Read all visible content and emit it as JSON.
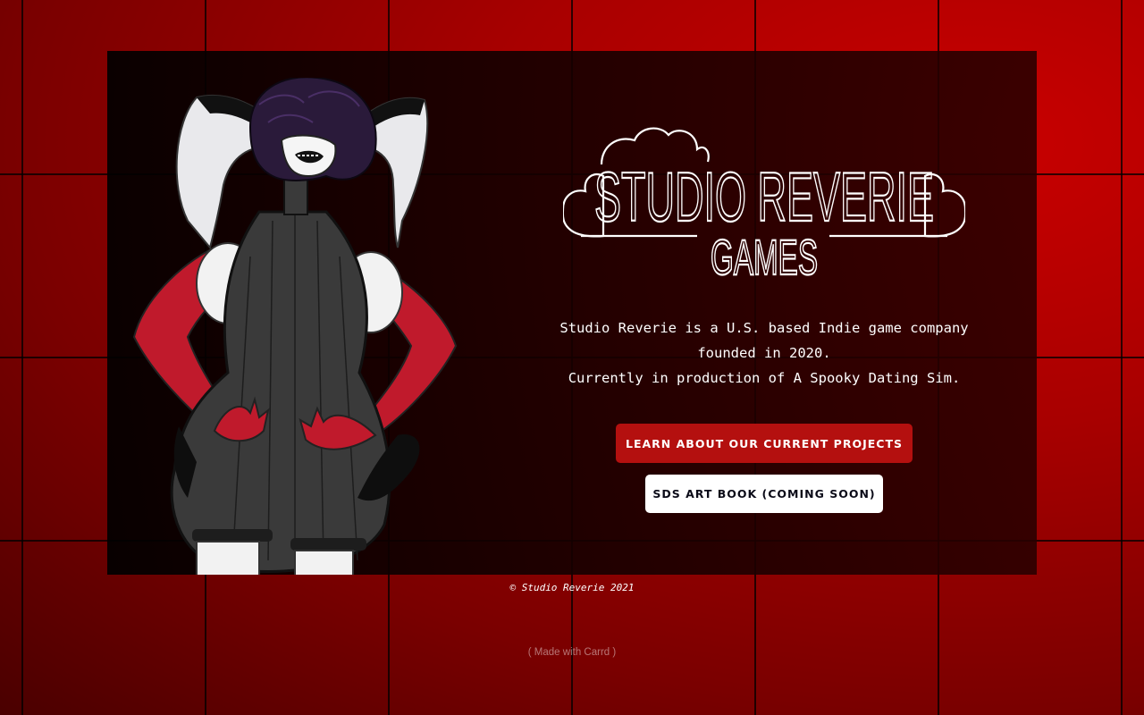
{
  "logo": {
    "line1": "STUDIO REVERIE",
    "line2": "GAMES"
  },
  "description": {
    "line1": "Studio Reverie is a U.S. based Indie game company",
    "line2": "founded in 2020.",
    "line3": "Currently in production of A Spooky Dating Sim."
  },
  "buttons": {
    "projects_label": "Learn about our current projects",
    "artbook_label": "SDS Art Book (Coming Soon)"
  },
  "footer": {
    "copyright": "© Studio Reverie 2021",
    "made_with": "( Made with Carrd )"
  },
  "colors": {
    "background_red": "#c90000",
    "primary_button": "#b4100f",
    "glove_red": "#c01a2c"
  }
}
